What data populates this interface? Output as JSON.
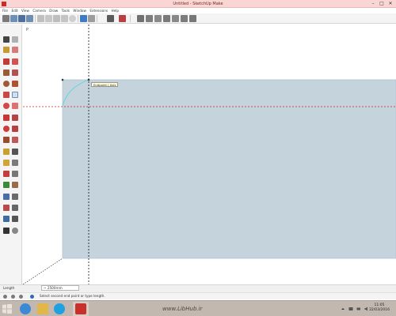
{
  "window": {
    "title": "Untitled - SketchUp Make",
    "minimize": "–",
    "maximize": "□",
    "close": "✕"
  },
  "menu": [
    "File",
    "Edit",
    "View",
    "Camera",
    "Draw",
    "Tools",
    "Window",
    "Extensions",
    "Help"
  ],
  "viewport": {
    "tooltip": "Endpoint | Axis"
  },
  "status": {
    "measure_label": "Length",
    "measure_value": "~ 2500mm",
    "hint": "Select second end point or type length."
  },
  "taskbar": {
    "brand": "www.LibHub.ir",
    "time": "11:05",
    "date": "22/03/2016"
  },
  "colors": {
    "rect_fill": "#c5d3dd",
    "rect_stroke": "#b4c4cf",
    "axis_red": "#cc2222",
    "axis_green": "#2aa02a",
    "axis_blue": "#2233cc",
    "arc": "#59d3e6"
  },
  "icons": {
    "toolbar": [
      "get-models-icon",
      "orbit-icon",
      "pan-icon",
      "zoom-icon",
      "scissors-icon",
      "paste-icon",
      "copy-icon",
      "erase-icon",
      "undo-icon",
      "redo-icon",
      "print-icon",
      "camera-icon",
      "iso-view-icon",
      "top-view-icon",
      "front-view-icon",
      "right-view-icon",
      "back-view-icon",
      "left-view-icon"
    ],
    "left": [
      "select-icon",
      "eraser-icon",
      "paint-icon",
      "components-icon",
      "line-icon",
      "freehand-icon",
      "rectangle-icon",
      "circle-icon",
      "polygon-icon",
      "arc-icon",
      "move-icon",
      "pushpull-icon",
      "rotate-icon",
      "followme-icon",
      "scale-icon",
      "offset-icon",
      "tape-icon",
      "dimension-icon",
      "protractor-icon",
      "text-icon",
      "axes-icon",
      "3dtext-icon",
      "orbit-icon",
      "pan-icon",
      "zoom-icon",
      "zoom-window-icon",
      "zoom-extents-icon",
      "previous-icon",
      "position-camera-icon",
      "walk-icon",
      "look-around-icon",
      "section-icon"
    ]
  }
}
